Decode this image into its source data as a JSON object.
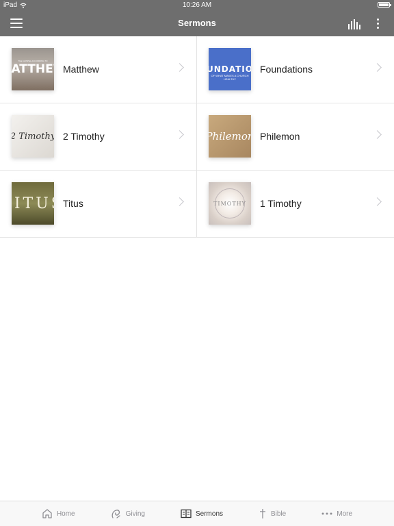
{
  "status_bar": {
    "device": "iPad",
    "time": "10:26 AM"
  },
  "navbar": {
    "title": "Sermons"
  },
  "series": [
    {
      "title": "Matthew",
      "art_text": "MATTHEW",
      "art_small": "THE GOSPEL ACCORDING TO"
    },
    {
      "title": "Foundations",
      "art_text": "UNDATIO",
      "art_small": "OF WHAT MAKES A CHURCH HEALTHY"
    },
    {
      "title": "2 Timothy",
      "art_text": "2 Timothy"
    },
    {
      "title": "Philemon",
      "art_text": "Philemon"
    },
    {
      "title": "Titus",
      "art_text": "TITUS"
    },
    {
      "title": "1 Timothy",
      "art_text": "TIMOTHY"
    }
  ],
  "tabbar": {
    "items": [
      {
        "label": "Home",
        "icon": "home-icon"
      },
      {
        "label": "Giving",
        "icon": "giving-icon"
      },
      {
        "label": "Sermons",
        "icon": "book-icon"
      },
      {
        "label": "Bible",
        "icon": "cross-icon"
      },
      {
        "label": "More",
        "icon": "more-icon"
      }
    ],
    "active": "Sermons"
  }
}
